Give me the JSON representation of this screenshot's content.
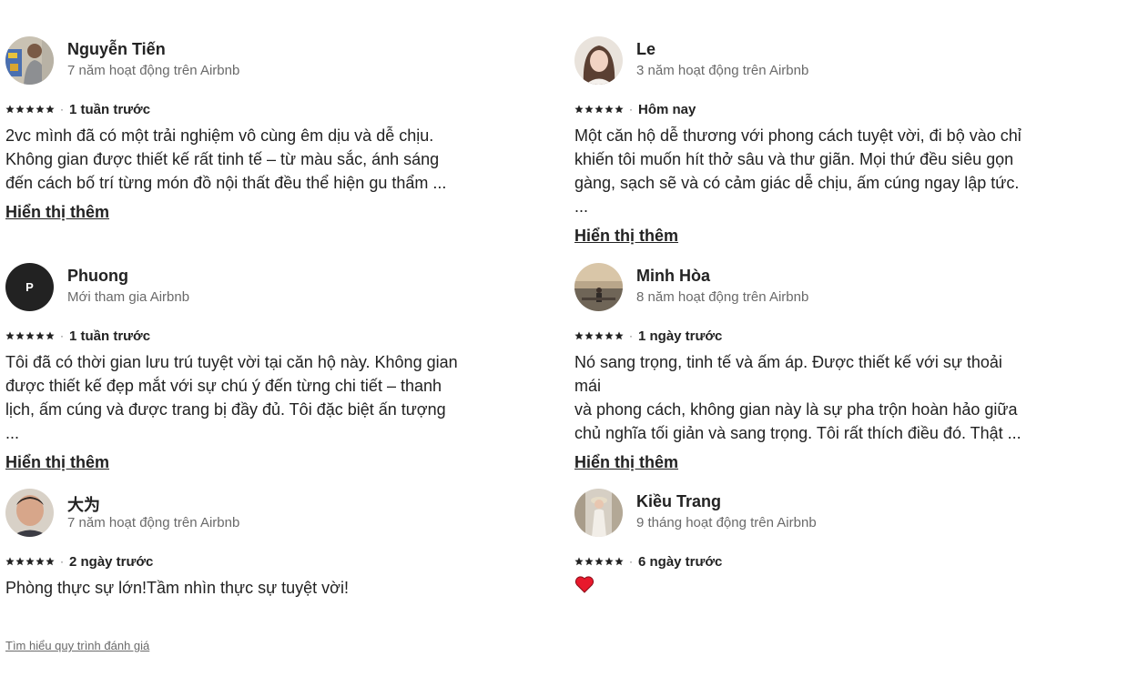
{
  "colors": {
    "text": "#222222",
    "muted": "#6a6a6a",
    "heart": "#e31c5f"
  },
  "reviews": [
    {
      "name": "Nguyễn Tiến",
      "tenure": "7 năm hoạt động trên Airbnb",
      "rating": 5,
      "date": "1 tuần trước",
      "text_lines": [
        "2vc mình đã có một trải nghiệm vô cùng êm dịu và dễ chịu.",
        "Không gian được thiết kế rất tinh tế – từ màu sắc, ánh sáng",
        "đến cách bố trí từng món đồ nội thất đều thể hiện gu thẩm ..."
      ],
      "show_more": "Hiển thị thêm"
    },
    {
      "name": "Le",
      "tenure": "3 năm hoạt động trên Airbnb",
      "rating": 5,
      "date": "Hôm nay",
      "text_lines": [
        "Một căn hộ dễ thương với phong cách tuyệt vời, đi bộ vào chỉ",
        "khiến tôi muốn hít thở sâu và thư giãn. Mọi thứ đều siêu gọn",
        "gàng, sạch sẽ và có cảm giác dễ chịu, ấm cúng ngay lập tức. ..."
      ],
      "show_more": "Hiển thị thêm"
    },
    {
      "name": "Phuong",
      "avatar_initial": "P",
      "tenure": "Mới tham gia Airbnb",
      "rating": 5,
      "date": "1 tuần trước",
      "text_lines": [
        "Tôi đã có thời gian lưu trú tuyệt vời tại căn hộ này. Không gian",
        "được thiết kế đẹp mắt với sự chú ý đến từng chi tiết – thanh",
        "lịch, ấm cúng và được trang bị đầy đủ. Tôi đặc biệt ấn tượng ..."
      ],
      "show_more": "Hiển thị thêm"
    },
    {
      "name": "Minh Hòa",
      "tenure": "8 năm hoạt động trên Airbnb",
      "rating": 5,
      "date": "1 ngày trước",
      "text_lines": [
        "Nó sang trọng, tinh tế và ấm áp. Được thiết kế với sự thoải mái",
        "và phong cách, không gian này là sự pha trộn hoàn hảo giữa",
        "chủ nghĩa tối giản và sang trọng. Tôi rất thích điều đó. Thật ..."
      ],
      "show_more": "Hiển thị thêm"
    },
    {
      "name": "大为",
      "tenure": "7 năm hoạt động trên Airbnb",
      "rating": 5,
      "date": "2 ngày trước",
      "text_lines": [
        "Phòng thực sự lớn!Tầm nhìn thực sự tuyệt vời!"
      ]
    },
    {
      "name": "Kiều Trang",
      "tenure": "9 tháng hoạt động trên Airbnb",
      "rating": 5,
      "date": "6 ngày trước",
      "text_emoji": "heart-emoji"
    }
  ],
  "footer": {
    "link_label": "Tìm hiểu quy trình đánh giá"
  }
}
